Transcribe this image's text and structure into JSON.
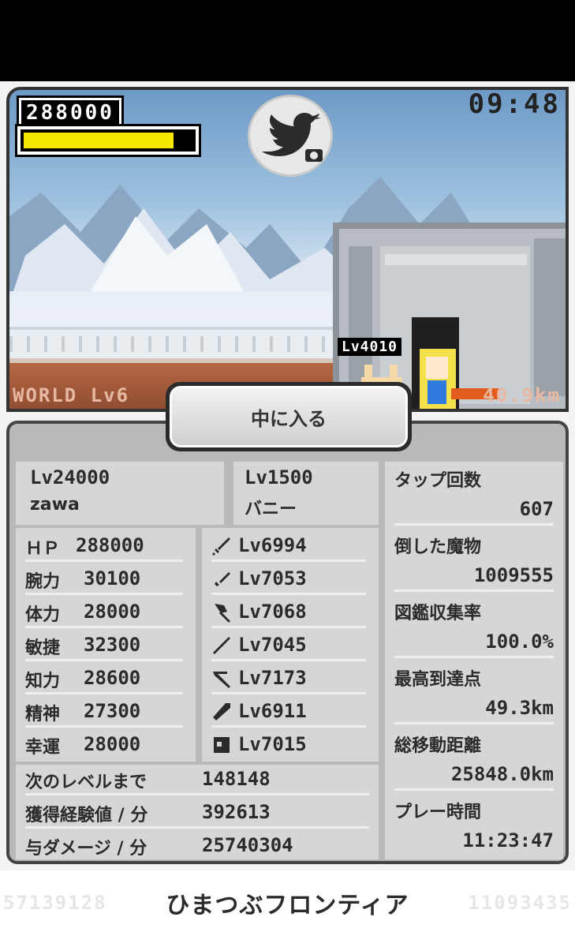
{
  "hud": {
    "score": "288000",
    "hp_fill": 0.92,
    "clock": "09:48"
  },
  "scene": {
    "world_label": "WORLD Lv6",
    "distance": "40.9km",
    "enemy_level": "Lv4010"
  },
  "enter_button": "中に入る",
  "player": {
    "level": "Lv24000",
    "name": "zawa"
  },
  "pet": {
    "level": "Lv1500",
    "name": "バニー"
  },
  "stats": [
    {
      "label": "ＨＰ",
      "value": "288000"
    },
    {
      "label": "腕力",
      "value": "30100"
    },
    {
      "label": "体力",
      "value": "28000"
    },
    {
      "label": "敏捷",
      "value": "32300"
    },
    {
      "label": "知力",
      "value": "28600"
    },
    {
      "label": "精神",
      "value": "27300"
    },
    {
      "label": "幸運",
      "value": "28000"
    }
  ],
  "equipment": [
    {
      "icon": "sword-icon",
      "level": "Lv6994"
    },
    {
      "icon": "dagger-icon",
      "level": "Lv7053"
    },
    {
      "icon": "axe-icon",
      "level": "Lv7068"
    },
    {
      "icon": "spear-icon",
      "level": "Lv7045"
    },
    {
      "icon": "bow-icon",
      "level": "Lv7173"
    },
    {
      "icon": "staff-icon",
      "level": "Lv6911"
    },
    {
      "icon": "armor-icon",
      "level": "Lv7015"
    }
  ],
  "progress": [
    {
      "label": "次のレベルまで",
      "value": "148148"
    },
    {
      "label": "獲得経験値 / 分",
      "value": "392613"
    },
    {
      "label": "与ダメージ / 分",
      "value": "25740304"
    }
  ],
  "records": [
    {
      "label": "タップ回数",
      "value": "607"
    },
    {
      "label": "倒した魔物",
      "value": "1009555"
    },
    {
      "label": "図鑑収集率",
      "value": "100.0%"
    },
    {
      "label": "最高到達点",
      "value": "49.3km"
    },
    {
      "label": "総移動距離",
      "value": "25848.0km"
    },
    {
      "label": "プレー時間",
      "value": "11:23:47"
    }
  ],
  "footer": {
    "title": "ひまつぶフロンティア",
    "left_ghost": "57139128",
    "right_ghost": "11093435"
  },
  "colors": {
    "hp": "#f5e800",
    "panel": "#b9b9b9",
    "cell": "#d6d6d6",
    "dirt": "#b96a45"
  }
}
